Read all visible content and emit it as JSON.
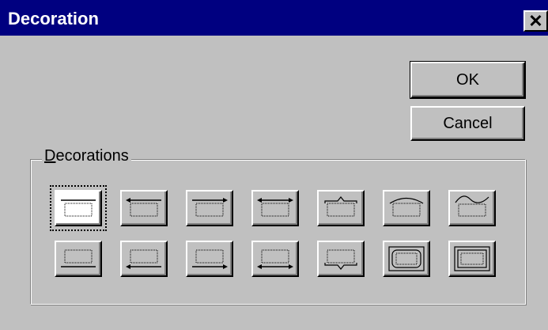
{
  "window": {
    "title": "Decoration",
    "close_glyph": "✕"
  },
  "buttons": {
    "ok_label": "OK",
    "cancel_label": "Cancel"
  },
  "group": {
    "label_underlined": "D",
    "label_rest": "ecorations"
  },
  "decorations": [
    "plain-box-decoration-icon",
    "left-arrow-top-decoration-icon",
    "right-arrow-top-decoration-icon",
    "double-arrow-top-decoration-icon",
    "top-bracket-decoration-icon",
    "top-arc-decoration-icon",
    "top-wave-decoration-icon",
    "bottom-line-decoration-icon",
    "left-arrow-bottom-decoration-icon",
    "right-arrow-bottom-decoration-icon",
    "double-arrow-bottom-decoration-icon",
    "bottom-bracket-decoration-icon",
    "rounded-frame-decoration-icon",
    "rectangle-frame-decoration-icon"
  ],
  "selected_index": 0
}
